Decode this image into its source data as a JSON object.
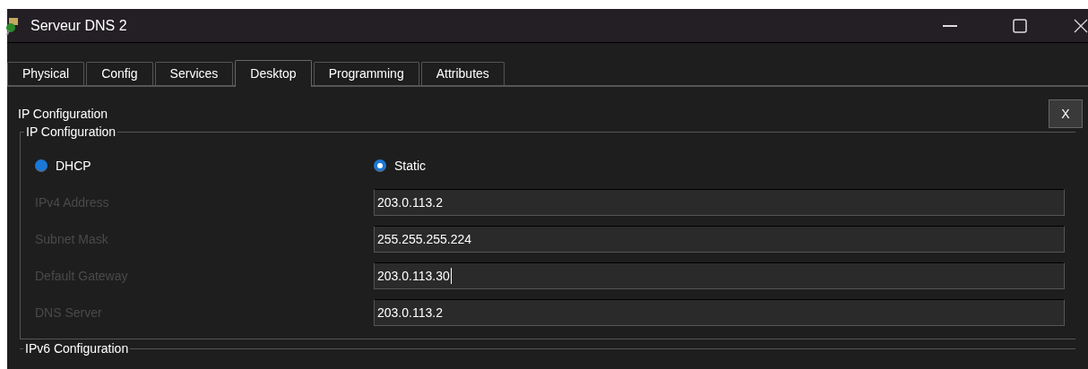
{
  "window": {
    "title": "Serveur DNS 2"
  },
  "tabs": [
    {
      "label": "Physical",
      "selected": false
    },
    {
      "label": "Config",
      "selected": false
    },
    {
      "label": "Services",
      "selected": false
    },
    {
      "label": "Desktop",
      "selected": true
    },
    {
      "label": "Programming",
      "selected": false
    },
    {
      "label": "Attributes",
      "selected": false
    }
  ],
  "panel": {
    "title": "IP Configuration",
    "close_button": "X"
  },
  "ipv4_group": {
    "legend": "IP Configuration",
    "modes": [
      {
        "label": "DHCP",
        "selected": false
      },
      {
        "label": "Static",
        "selected": true
      }
    ],
    "fields": [
      {
        "label": "IPv4 Address",
        "value": "203.0.113.2",
        "focused": false
      },
      {
        "label": "Subnet Mask",
        "value": "255.255.255.224",
        "focused": false
      },
      {
        "label": "Default Gateway",
        "value": "203.0.113.30",
        "focused": true
      },
      {
        "label": "DNS Server",
        "value": "203.0.113.2",
        "focused": false
      }
    ]
  },
  "ipv6_group": {
    "legend": "IPv6 Configuration"
  }
}
